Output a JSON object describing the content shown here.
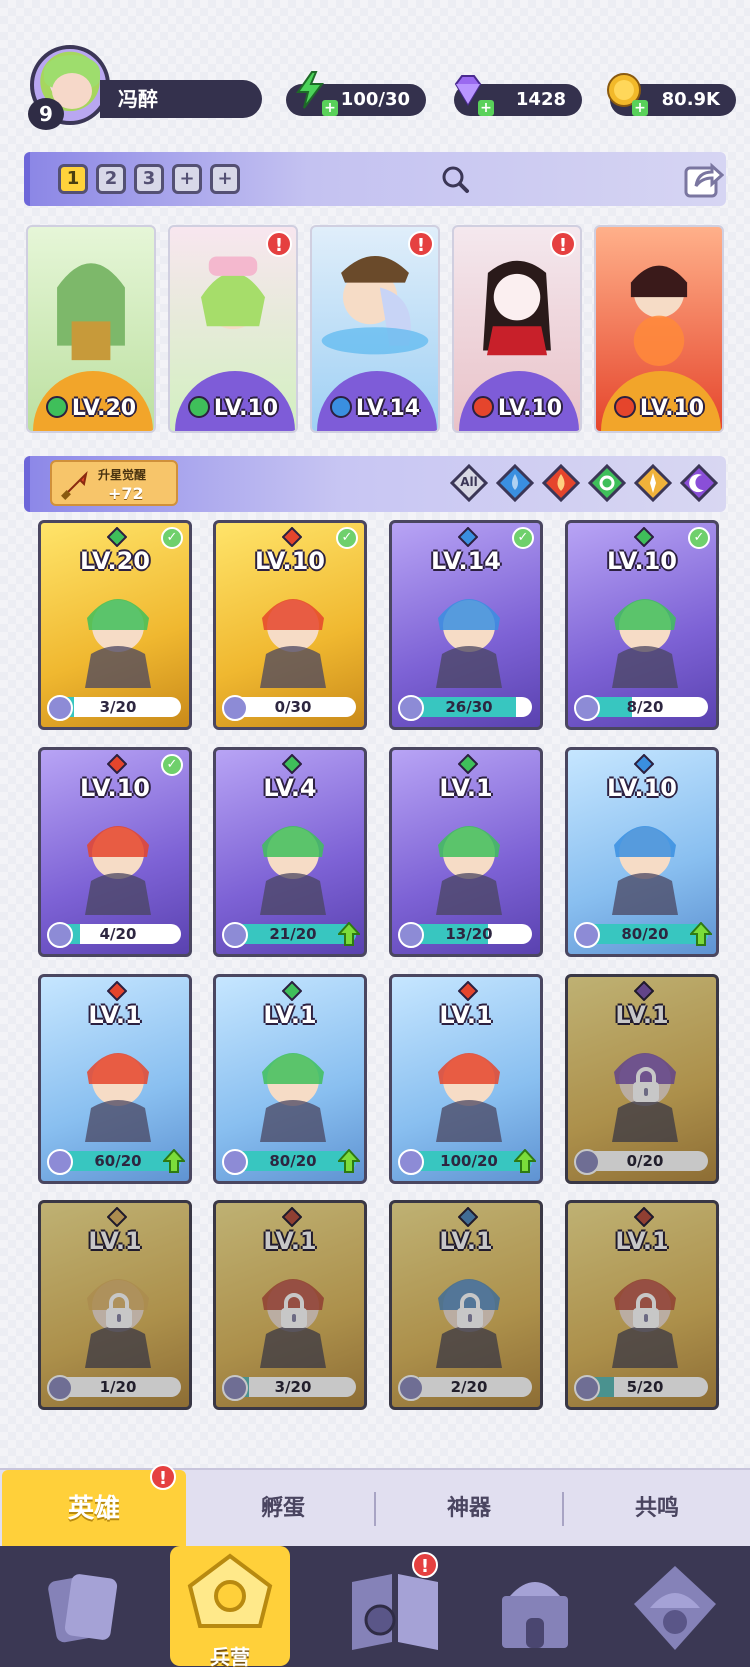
{
  "player": {
    "level": "9",
    "name": "冯醉"
  },
  "resources": [
    {
      "name": "energy",
      "icon": "lightning-icon",
      "value": "100/30",
      "color": "#4cd35a"
    },
    {
      "name": "gems",
      "icon": "diamond-icon",
      "value": "1428",
      "color": "#9a6af0"
    },
    {
      "name": "coins",
      "icon": "coin-icon",
      "value": "80.9K",
      "color": "#f2b92a"
    }
  ],
  "team_tabs": [
    "1",
    "2",
    "3",
    "+",
    "+"
  ],
  "team": [
    {
      "level": "LV.20",
      "element": "wind",
      "alert": ""
    },
    {
      "level": "LV.10",
      "element": "wind",
      "alert": "!"
    },
    {
      "level": "LV.14",
      "element": "water",
      "alert": "!"
    },
    {
      "level": "LV.10",
      "element": "fire",
      "alert": "!"
    },
    {
      "level": "LV.10",
      "element": "fire",
      "alert": ""
    }
  ],
  "awaken": {
    "label": "升星觉醒",
    "value": "+72"
  },
  "filters": [
    "All",
    "water",
    "fire",
    "wind",
    "light",
    "dark"
  ],
  "filter_all_label": "All",
  "heroes": [
    {
      "level": "LV.20",
      "element": "wind",
      "frame": "gold",
      "progress": "3/20",
      "fill": 0.15,
      "check": true,
      "locked": false,
      "upgrade": false
    },
    {
      "level": "LV.10",
      "element": "fire",
      "frame": "gold",
      "progress": "0/30",
      "fill": 0.0,
      "check": true,
      "locked": false,
      "upgrade": false
    },
    {
      "level": "LV.14",
      "element": "water",
      "frame": "purple",
      "progress": "26/30",
      "fill": 0.87,
      "check": true,
      "locked": false,
      "upgrade": false
    },
    {
      "level": "LV.10",
      "element": "wind",
      "frame": "purple",
      "progress": "8/20",
      "fill": 0.4,
      "check": true,
      "locked": false,
      "upgrade": false
    },
    {
      "level": "LV.10",
      "element": "fire",
      "frame": "purple",
      "progress": "4/20",
      "fill": 0.2,
      "check": true,
      "locked": false,
      "upgrade": false
    },
    {
      "level": "LV.4",
      "element": "wind",
      "frame": "purple",
      "progress": "21/20",
      "fill": 1.0,
      "check": false,
      "locked": false,
      "upgrade": true
    },
    {
      "level": "LV.1",
      "element": "wind",
      "frame": "purple",
      "progress": "13/20",
      "fill": 0.65,
      "check": false,
      "locked": false,
      "upgrade": false
    },
    {
      "level": "LV.10",
      "element": "water",
      "frame": "blue",
      "progress": "80/20",
      "fill": 1.0,
      "check": false,
      "locked": false,
      "upgrade": true
    },
    {
      "level": "LV.1",
      "element": "fire",
      "frame": "blue",
      "progress": "60/20",
      "fill": 1.0,
      "check": false,
      "locked": false,
      "upgrade": true
    },
    {
      "level": "LV.1",
      "element": "wind",
      "frame": "blue",
      "progress": "80/20",
      "fill": 1.0,
      "check": false,
      "locked": false,
      "upgrade": true
    },
    {
      "level": "LV.1",
      "element": "fire",
      "frame": "blue",
      "progress": "100/20",
      "fill": 1.0,
      "check": false,
      "locked": false,
      "upgrade": true
    },
    {
      "level": "LV.1",
      "element": "dark",
      "frame": "gold",
      "progress": "0/20",
      "fill": 0.0,
      "check": false,
      "locked": true,
      "upgrade": false
    },
    {
      "level": "LV.1",
      "element": "light",
      "frame": "gold",
      "progress": "1/20",
      "fill": 0.05,
      "check": false,
      "locked": true,
      "upgrade": false
    },
    {
      "level": "LV.1",
      "element": "fire",
      "frame": "gold",
      "progress": "3/20",
      "fill": 0.15,
      "check": false,
      "locked": true,
      "upgrade": false
    },
    {
      "level": "LV.1",
      "element": "water",
      "frame": "gold",
      "progress": "2/20",
      "fill": 0.1,
      "check": false,
      "locked": true,
      "upgrade": false
    },
    {
      "level": "LV.1",
      "element": "fire",
      "frame": "gold",
      "progress": "5/20",
      "fill": 0.25,
      "check": false,
      "locked": true,
      "upgrade": false
    }
  ],
  "subtabs": [
    {
      "label": "英雄",
      "active": true,
      "alert": "!"
    },
    {
      "label": "孵蛋",
      "active": false,
      "alert": ""
    },
    {
      "label": "神器",
      "active": false,
      "alert": ""
    },
    {
      "label": "共鸣",
      "active": false,
      "alert": ""
    }
  ],
  "nav": [
    {
      "icon": "cards-icon",
      "label": ""
    },
    {
      "icon": "barracks-icon",
      "label": "兵营",
      "active": true
    },
    {
      "icon": "map-book-icon",
      "label": "",
      "alert": "!"
    },
    {
      "icon": "castle-icon",
      "label": ""
    },
    {
      "icon": "mushroom-guild-icon",
      "label": ""
    }
  ],
  "element_colors": {
    "wind": "#3fbf5a",
    "fire": "#e5452c",
    "water": "#3a8fe0",
    "light": "#f0b23a",
    "dark": "#8a4fd8"
  }
}
